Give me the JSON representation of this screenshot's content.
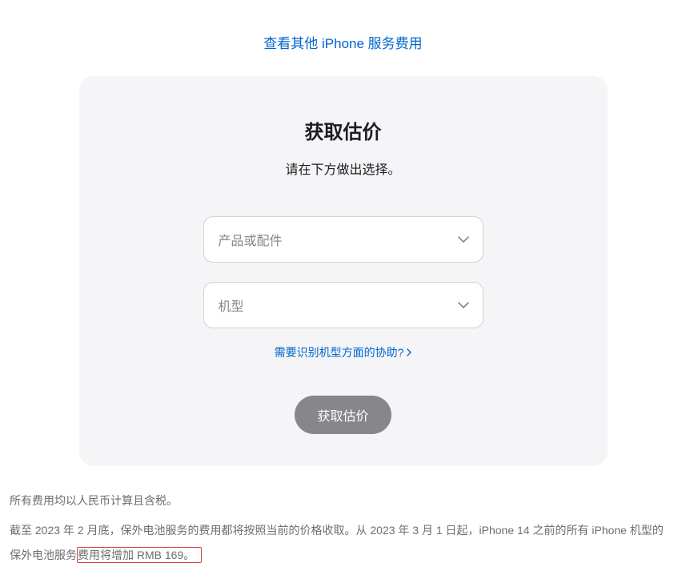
{
  "topLink": {
    "label": "查看其他 iPhone 服务费用"
  },
  "card": {
    "title": "获取估价",
    "subtitle": "请在下方做出选择。",
    "select1": {
      "placeholder": "产品或配件"
    },
    "select2": {
      "placeholder": "机型"
    },
    "helpLink": {
      "label": "需要识别机型方面的协助?"
    },
    "submitButton": {
      "label": "获取估价"
    }
  },
  "footer": {
    "line1": "所有费用均以人民币计算且含税。",
    "line2_pre": "截至 2023 年 2 月底，保外电池服务的费用都将按照当前的价格收取。从 2023 年 3 月 1 日起，iPhone 14 之前的所有 iPhone 机型的保外电池服务",
    "line2_highlight": "费用将增加 RMB 169。"
  }
}
